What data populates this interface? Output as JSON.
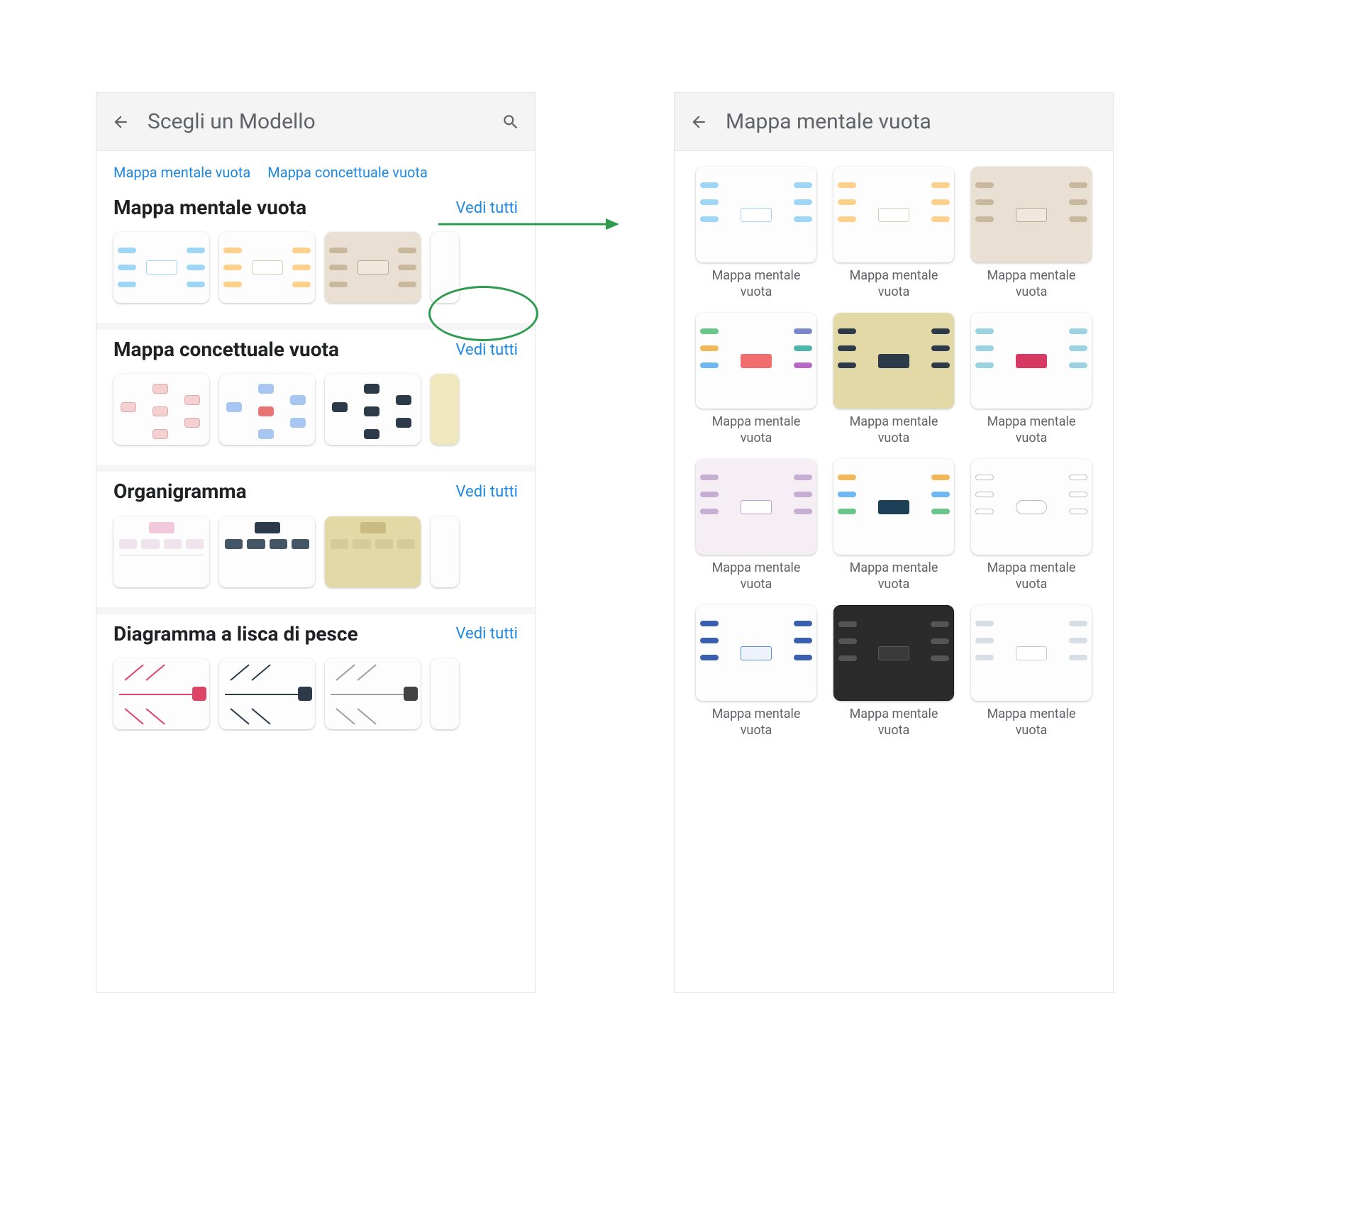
{
  "left": {
    "appbar": {
      "title": "Scegli un Modello"
    },
    "chips": [
      "Mappa mentale vuota",
      "Mappa concettuale vuota"
    ],
    "see_all": "Vedi tutti",
    "sections": [
      {
        "title": "Mappa mentale vuota"
      },
      {
        "title": "Mappa concettuale vuota"
      },
      {
        "title": "Organigramma"
      },
      {
        "title": "Diagramma a lisca di pesce"
      }
    ]
  },
  "right": {
    "appbar": {
      "title": "Mappa mentale vuota"
    },
    "item_label": "Mappa mentale vuota",
    "count": 12
  },
  "annotation": {
    "highlight_target": "see-all-0"
  }
}
